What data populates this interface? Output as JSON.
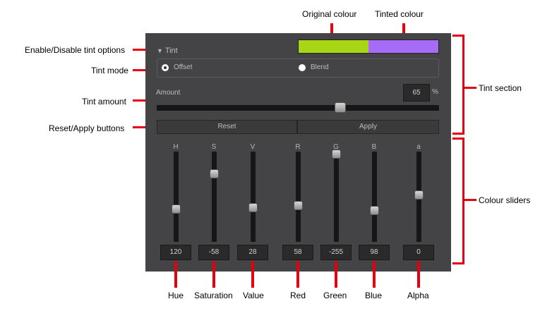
{
  "annotations": {
    "original_colour": "Original colour",
    "tinted_colour": "Tinted colour",
    "enable_disable": "Enable/Disable tint options",
    "tint_mode": "Tint mode",
    "tint_amount": "Tint  amount",
    "reset_apply": "Reset/Apply buttons",
    "tint_section": "Tint section",
    "colour_sliders": "Colour sliders",
    "hue": "Hue",
    "saturation": "Saturation",
    "value": "Value",
    "red": "Red",
    "green": "Green",
    "blue": "Blue",
    "alpha": "Alpha"
  },
  "panel": {
    "tint_header": "Tint",
    "swatches": {
      "original": "#a7d615",
      "tinted": "#a66cf7"
    },
    "mode": {
      "offset": "Offset",
      "blend": "Blend",
      "selected": "offset"
    },
    "amount": {
      "label": "Amount",
      "value": "65",
      "unit": "%",
      "fraction": 0.65
    },
    "buttons": {
      "reset": "Reset",
      "apply": "Apply"
    },
    "sliders": [
      {
        "label": "H",
        "value": "120",
        "level": 0.35
      },
      {
        "label": "S",
        "value": "-58",
        "level": 0.77
      },
      {
        "label": "V",
        "value": "28",
        "level": 0.37
      },
      {
        "label": "R",
        "value": "58",
        "level": 0.39
      },
      {
        "label": "G",
        "value": "-255",
        "level": 1.0
      },
      {
        "label": "B",
        "value": "98",
        "level": 0.33
      },
      {
        "label": "a",
        "value": "0",
        "level": 0.52
      }
    ]
  },
  "colors": {
    "accent": "#e3000f",
    "panel": "#444446"
  }
}
